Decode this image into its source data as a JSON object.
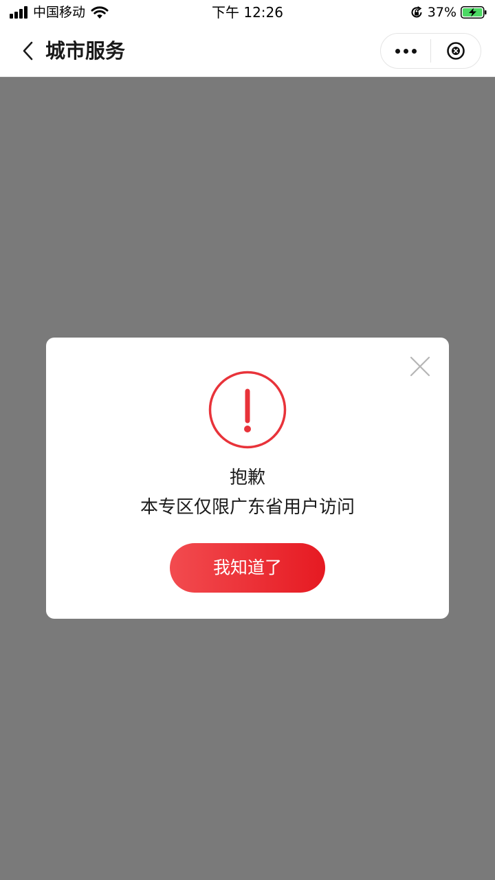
{
  "status_bar": {
    "carrier": "中国移动",
    "time": "下午 12:26",
    "battery_percent": "37%",
    "battery_level": 0.37,
    "icons": [
      "signal-icon",
      "wifi-icon",
      "rotation-lock-icon",
      "battery-charging-icon"
    ]
  },
  "nav": {
    "title": "城市服务",
    "icons": [
      "back-chevron-icon",
      "more-dots-icon",
      "close-circle-icon"
    ]
  },
  "dialog": {
    "title": "抱歉",
    "message": "本专区仅限广东省用户访问",
    "button_label": "我知道了",
    "icons": [
      "alert-circle-icon",
      "close-x-icon"
    ]
  },
  "colors": {
    "overlay": "#7a7a7a",
    "accent": "#e61a22",
    "accent_start": "#f24b4f",
    "battery_green": "#4cd964"
  }
}
